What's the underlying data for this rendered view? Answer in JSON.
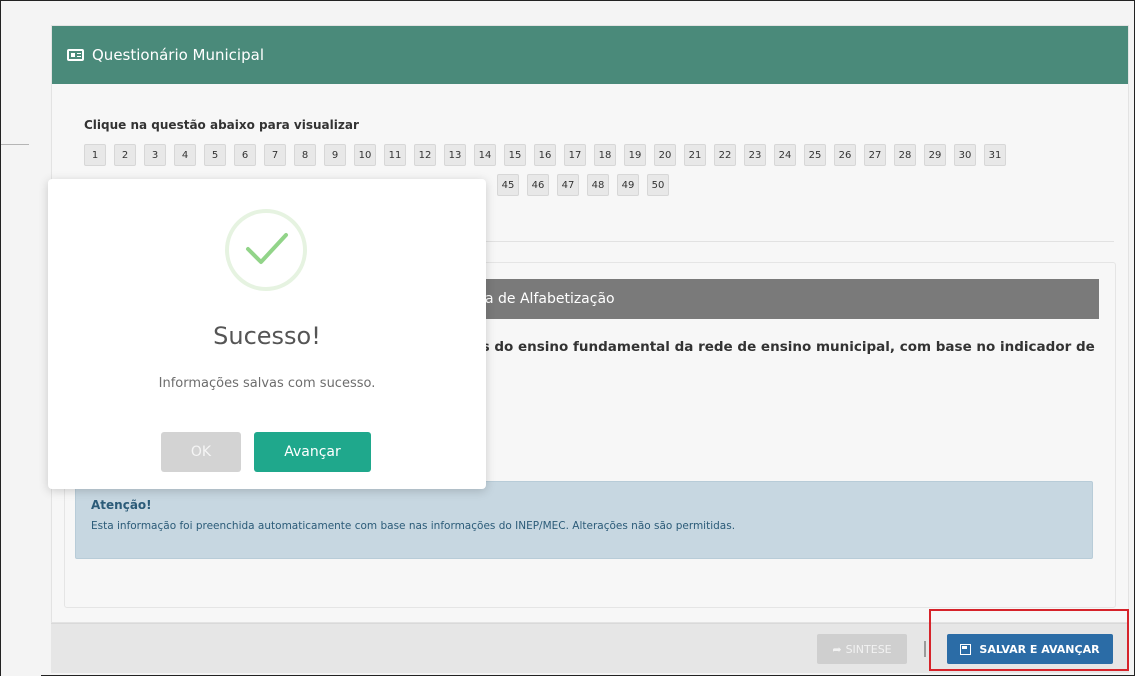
{
  "panel": {
    "title": "Questionário Municipal"
  },
  "questions": {
    "title": "Clique na questão abaixo para visualizar",
    "row1": [
      "1",
      "2",
      "3",
      "4",
      "5",
      "6",
      "7",
      "8",
      "9",
      "10",
      "11",
      "12",
      "13",
      "14",
      "15",
      "16",
      "17",
      "18",
      "19",
      "20",
      "21",
      "22",
      "23",
      "24",
      "25",
      "26",
      "27",
      "28",
      "29",
      "30",
      "31"
    ],
    "row2_visible": [
      "45",
      "46",
      "47",
      "48",
      "49",
      "50"
    ]
  },
  "section": {
    "title_partial": "a de Alfabetização",
    "question_partial": "is do ensino fundamental da rede de ensino municipal, com base no indicador de"
  },
  "alert": {
    "title": "Atenção!",
    "text": "Esta informação foi preenchida automaticamente com base nas informações do INEP/MEC. Alterações não são permitidas."
  },
  "footer": {
    "sintese_label": "SINTESE",
    "salvar_label": "SALVAR E AVANÇAR"
  },
  "modal": {
    "title": "Sucesso!",
    "text": "Informações salvas com sucesso.",
    "ok_label": "OK",
    "avancar_label": "Avançar"
  },
  "colors": {
    "header_green": "#4a8a7a",
    "success_teal": "#1fa88c",
    "primary_blue": "#2b6ca6",
    "highlight_red": "#d6232a"
  }
}
